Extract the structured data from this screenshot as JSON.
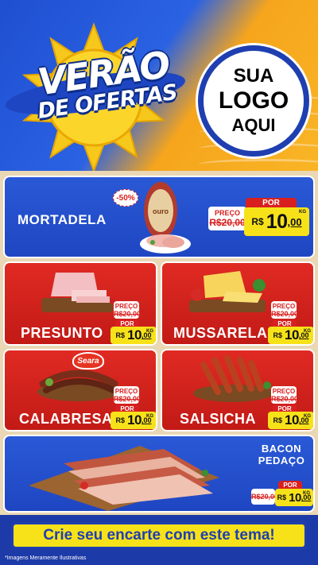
{
  "header": {
    "title_line1": "VERÃO",
    "title_line2": "DE OFERTAS",
    "logo_lines": [
      "SUA",
      "LOGO",
      "AQUI"
    ]
  },
  "products": {
    "mortadela": {
      "name": "MORTADELA",
      "discount": "-50%",
      "brand_label": "OURO",
      "old_label": "PREÇO",
      "old_price": "R$20,00",
      "por": "POR",
      "currency": "R$",
      "price_int": "10",
      "price_dec": ",00",
      "unit": "KG"
    },
    "presunto": {
      "name": "PRESUNTO",
      "old_label": "PREÇO",
      "old_price": "R$20,00",
      "por": "POR",
      "currency": "R$",
      "price_int": "10",
      "price_dec": ",00",
      "unit": "KG"
    },
    "mussarela": {
      "name": "MUSSARELA",
      "old_label": "PREÇO",
      "old_price": "R$20,00",
      "por": "POR",
      "currency": "R$",
      "price_int": "10",
      "price_dec": ",00",
      "unit": "KG"
    },
    "calabresa": {
      "name": "CALABRESA",
      "brand_label": "Seara",
      "old_label": "PREÇO",
      "old_price": "R$20,00",
      "por": "POR",
      "currency": "R$",
      "price_int": "10",
      "price_dec": ",00",
      "unit": "KG"
    },
    "salsicha": {
      "name": "SALSICHA",
      "old_label": "PREÇO",
      "old_price": "R$20,00",
      "por": "POR",
      "currency": "R$",
      "price_int": "10",
      "price_dec": ",00",
      "unit": "KG"
    },
    "bacon": {
      "name_line1": "BACON",
      "name_line2": "PEDAÇO",
      "old_price": "R$20,00",
      "por": "POR",
      "currency": "R$",
      "price_int": "10",
      "price_dec": ",00",
      "unit": "KG"
    }
  },
  "cta": {
    "label": "Crie seu encarte com este tema!"
  },
  "disclaimer": "*Imagens Meramente Ilustrativas",
  "colors": {
    "blue": "#1f46c2",
    "red": "#d92020",
    "yellow": "#f7e21a",
    "orange": "#f6a51c"
  }
}
